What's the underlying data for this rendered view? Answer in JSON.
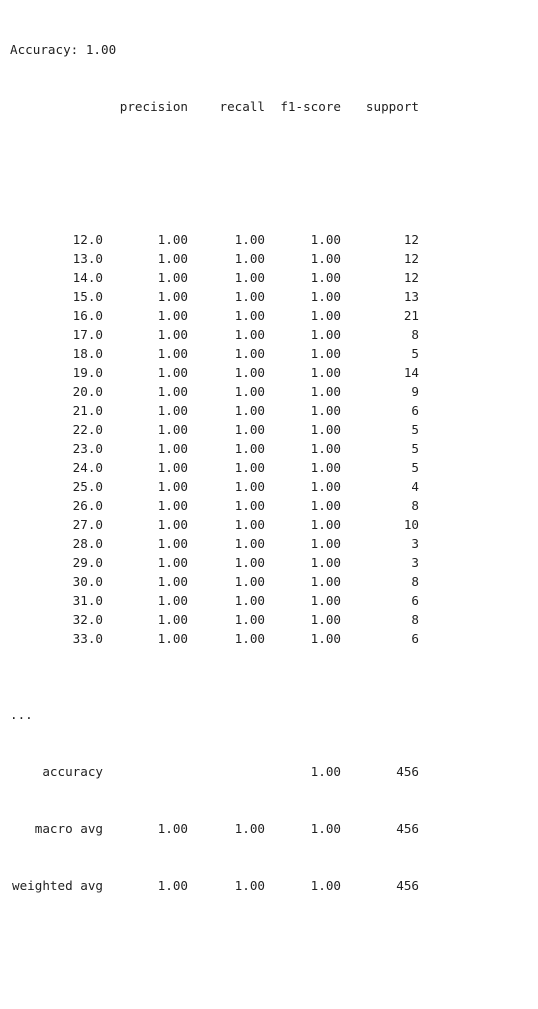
{
  "accuracy_line": "Accuracy: 1.00",
  "headers": {
    "precision": "precision",
    "recall": "recall",
    "f1": "f1-score",
    "support": "support"
  },
  "rows": [
    {
      "label": "12.0",
      "precision": "1.00",
      "recall": "1.00",
      "f1": "1.00",
      "support": "12"
    },
    {
      "label": "13.0",
      "precision": "1.00",
      "recall": "1.00",
      "f1": "1.00",
      "support": "12"
    },
    {
      "label": "14.0",
      "precision": "1.00",
      "recall": "1.00",
      "f1": "1.00",
      "support": "12"
    },
    {
      "label": "15.0",
      "precision": "1.00",
      "recall": "1.00",
      "f1": "1.00",
      "support": "13"
    },
    {
      "label": "16.0",
      "precision": "1.00",
      "recall": "1.00",
      "f1": "1.00",
      "support": "21"
    },
    {
      "label": "17.0",
      "precision": "1.00",
      "recall": "1.00",
      "f1": "1.00",
      "support": "8"
    },
    {
      "label": "18.0",
      "precision": "1.00",
      "recall": "1.00",
      "f1": "1.00",
      "support": "5"
    },
    {
      "label": "19.0",
      "precision": "1.00",
      "recall": "1.00",
      "f1": "1.00",
      "support": "14"
    },
    {
      "label": "20.0",
      "precision": "1.00",
      "recall": "1.00",
      "f1": "1.00",
      "support": "9"
    },
    {
      "label": "21.0",
      "precision": "1.00",
      "recall": "1.00",
      "f1": "1.00",
      "support": "6"
    },
    {
      "label": "22.0",
      "precision": "1.00",
      "recall": "1.00",
      "f1": "1.00",
      "support": "5"
    },
    {
      "label": "23.0",
      "precision": "1.00",
      "recall": "1.00",
      "f1": "1.00",
      "support": "5"
    },
    {
      "label": "24.0",
      "precision": "1.00",
      "recall": "1.00",
      "f1": "1.00",
      "support": "5"
    },
    {
      "label": "25.0",
      "precision": "1.00",
      "recall": "1.00",
      "f1": "1.00",
      "support": "4"
    },
    {
      "label": "26.0",
      "precision": "1.00",
      "recall": "1.00",
      "f1": "1.00",
      "support": "8"
    },
    {
      "label": "27.0",
      "precision": "1.00",
      "recall": "1.00",
      "f1": "1.00",
      "support": "10"
    },
    {
      "label": "28.0",
      "precision": "1.00",
      "recall": "1.00",
      "f1": "1.00",
      "support": "3"
    },
    {
      "label": "29.0",
      "precision": "1.00",
      "recall": "1.00",
      "f1": "1.00",
      "support": "3"
    },
    {
      "label": "30.0",
      "precision": "1.00",
      "recall": "1.00",
      "f1": "1.00",
      "support": "8"
    },
    {
      "label": "31.0",
      "precision": "1.00",
      "recall": "1.00",
      "f1": "1.00",
      "support": "6"
    },
    {
      "label": "32.0",
      "precision": "1.00",
      "recall": "1.00",
      "f1": "1.00",
      "support": "8"
    },
    {
      "label": "33.0",
      "precision": "1.00",
      "recall": "1.00",
      "f1": "1.00",
      "support": "6"
    }
  ],
  "ellipsis": "...",
  "summary": {
    "accuracy": {
      "label": "accuracy",
      "f1": "1.00",
      "support": "456"
    },
    "macro_avg": {
      "label": "macro avg",
      "precision": "1.00",
      "recall": "1.00",
      "f1": "1.00",
      "support": "456"
    },
    "weighted_avg": {
      "label": "weighted avg",
      "precision": "1.00",
      "recall": "1.00",
      "f1": "1.00",
      "support": "456"
    }
  }
}
